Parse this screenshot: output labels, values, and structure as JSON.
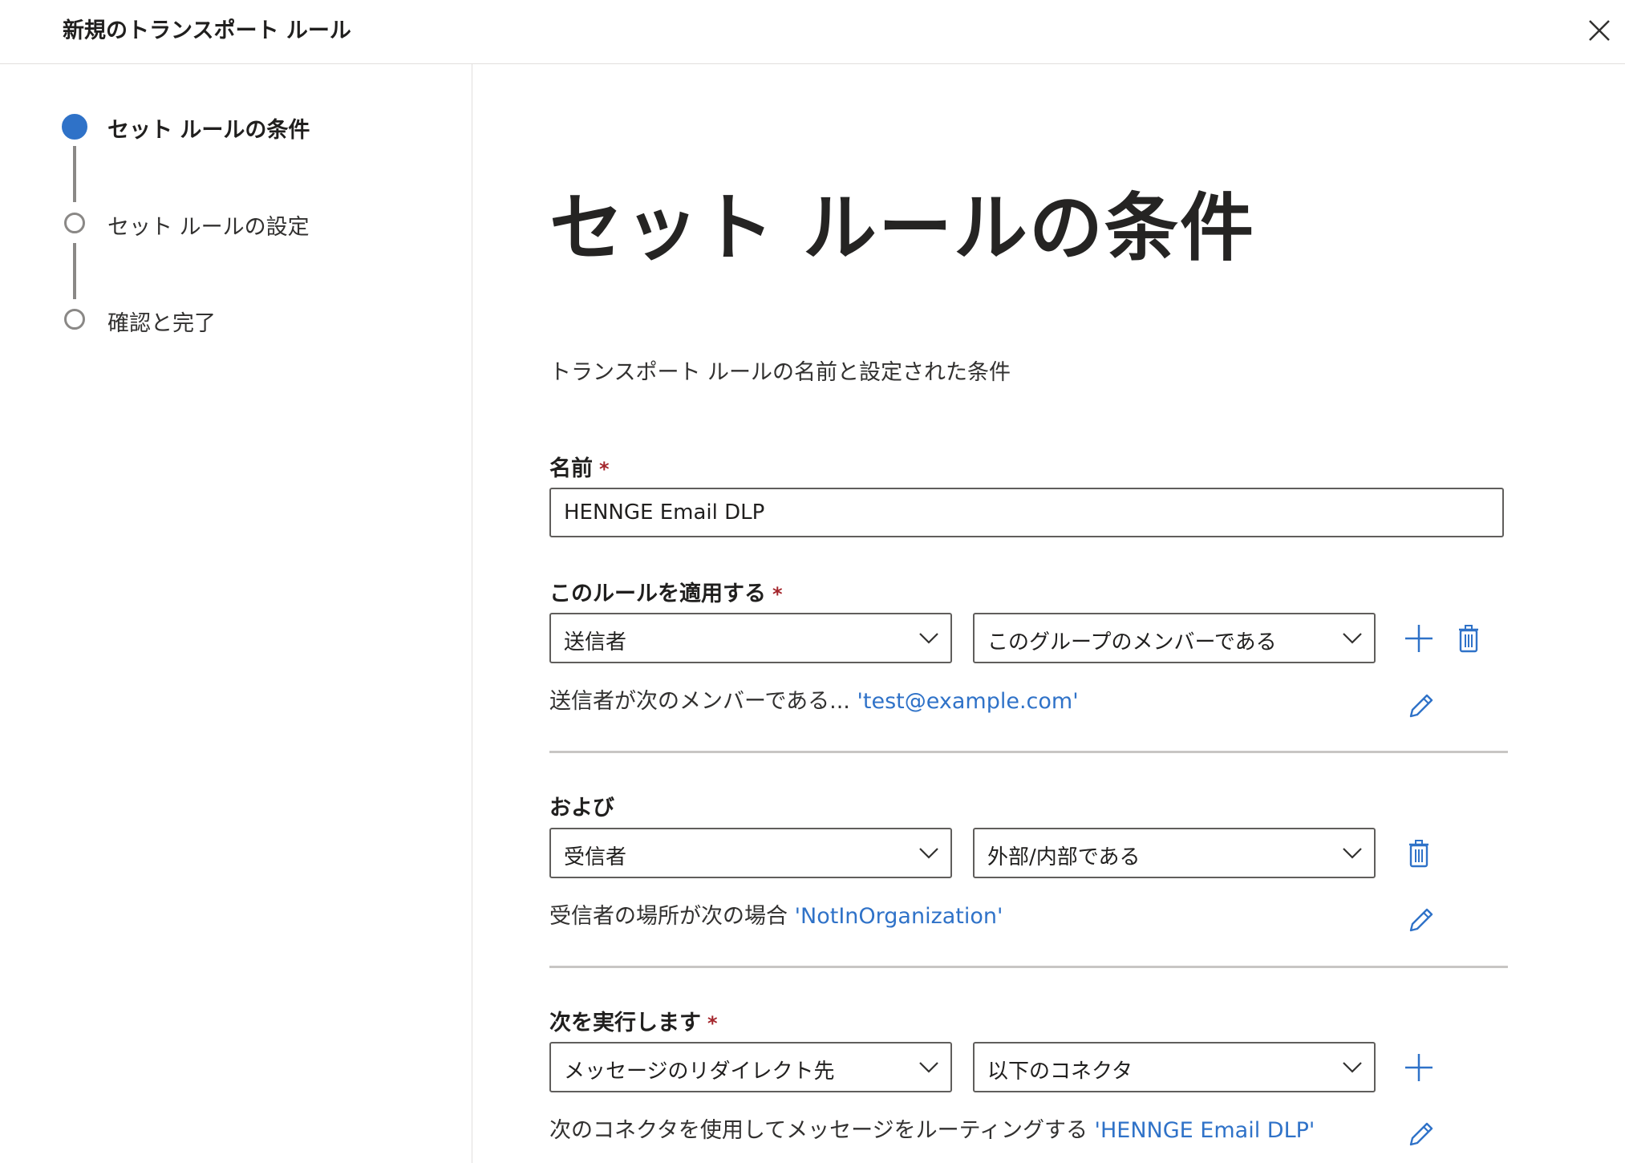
{
  "header": {
    "title": "新規のトランスポート ルール",
    "close_icon": "close-icon"
  },
  "steps": [
    {
      "label": "セット ルールの条件",
      "state": "active"
    },
    {
      "label": "セット ルールの設定",
      "state": "pending"
    },
    {
      "label": "確認と完了",
      "state": "pending"
    }
  ],
  "main": {
    "title": "セット ルールの条件",
    "description": "トランスポート ルールの名前と設定された条件",
    "name_field": {
      "label": "名前",
      "required_mark": "*",
      "value": "HENNGE Email DLP"
    },
    "apply_rule": {
      "label": "このルールを適用する",
      "required_mark": "*",
      "condition_type": "送信者",
      "condition_operator": "このグループのメンバーである",
      "summary_text": "送信者が次のメンバーである...",
      "summary_value": "'test@example.com'"
    },
    "and_rule": {
      "label": "および",
      "condition_type": "受信者",
      "condition_operator": "外部/内部である",
      "summary_text": "受信者の場所が次の場合",
      "summary_value": "'NotInOrganization'"
    },
    "action": {
      "label": "次を実行します",
      "required_mark": "*",
      "action_type": "メッセージのリダイレクト先",
      "action_target": "以下のコネクタ",
      "summary_text": "次のコネクタを使用してメッセージをルーティングする",
      "summary_value": "'HENNGE Email DLP'"
    }
  },
  "colors": {
    "accent": "#2f72c8",
    "required": "#a4262c",
    "border": "#605e5c",
    "divider": "#c8c6c4"
  }
}
